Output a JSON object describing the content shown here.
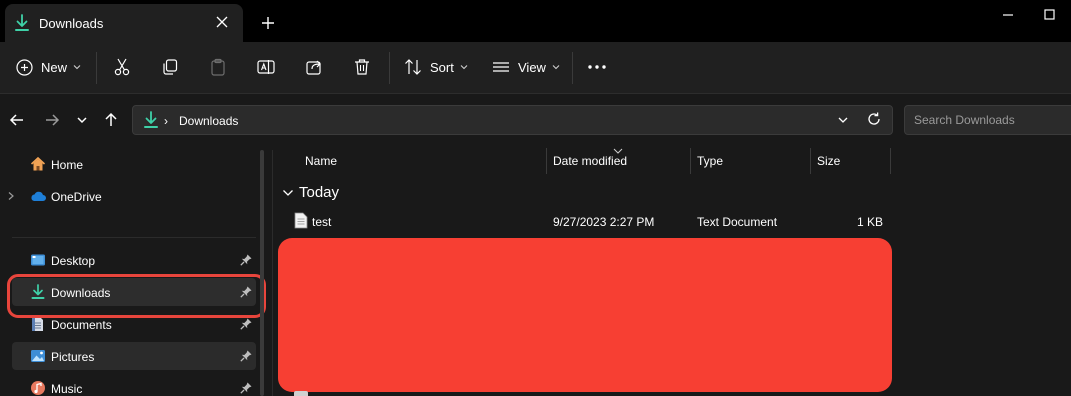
{
  "tab": {
    "title": "Downloads"
  },
  "commands": {
    "new": "New",
    "sort": "Sort",
    "view": "View"
  },
  "address": {
    "crumb": "Downloads",
    "search_placeholder": "Search Downloads"
  },
  "sidebar": {
    "items": [
      {
        "label": "Home"
      },
      {
        "label": "OneDrive"
      },
      {
        "label": "Desktop"
      },
      {
        "label": "Downloads"
      },
      {
        "label": "Documents"
      },
      {
        "label": "Pictures"
      },
      {
        "label": "Music"
      }
    ]
  },
  "columns": {
    "name": "Name",
    "date": "Date modified",
    "type": "Type",
    "size": "Size"
  },
  "group": {
    "label": "Today"
  },
  "files": [
    {
      "name": "test",
      "date": "9/27/2023 2:27 PM",
      "type": "Text Document",
      "size": "1 KB"
    }
  ],
  "colors": {
    "accent": "#3fd1a8",
    "highlight": "#e8453c",
    "redaction": "#f73f33"
  }
}
